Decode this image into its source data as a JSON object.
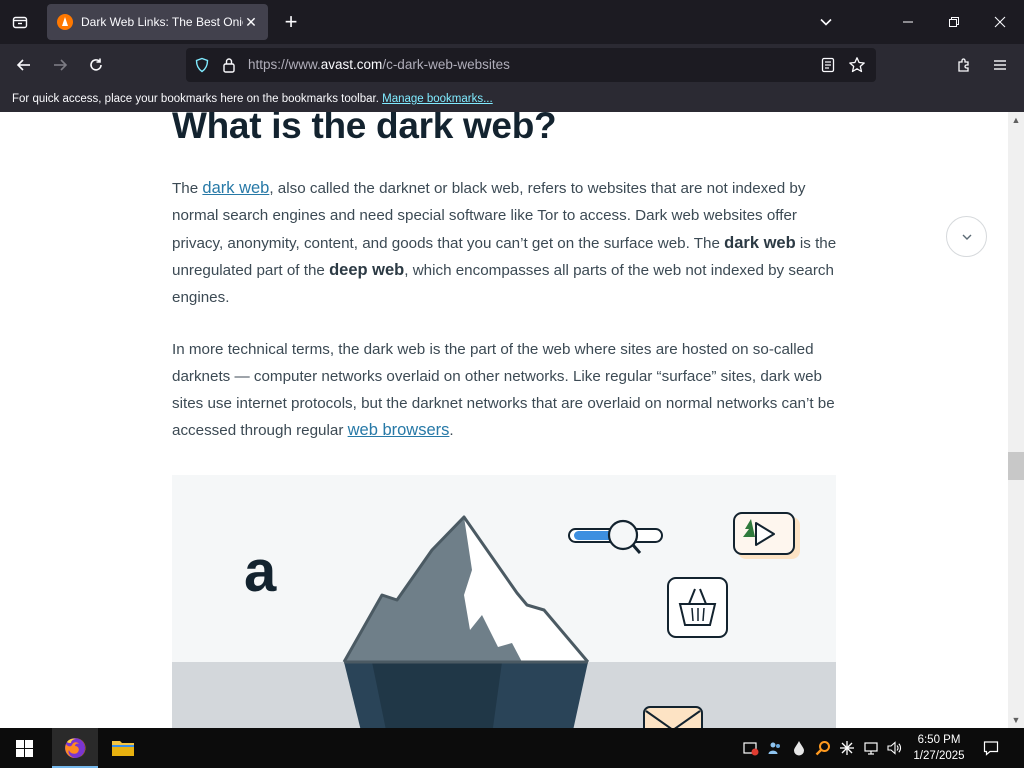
{
  "browser": {
    "tab": {
      "title": "Dark Web Links: The Best Onion"
    },
    "url": {
      "prefix": "https://www.",
      "host": "avast.com",
      "path": "/c-dark-web-websites"
    },
    "bookmarks_bar": {
      "text": "For quick access, place your bookmarks here on the bookmarks toolbar.",
      "link": "Manage bookmarks..."
    }
  },
  "article": {
    "heading": "What is the dark web?",
    "p1": {
      "t1": "The ",
      "l1": "dark web",
      "t2": ", also called the darknet or black web, refers to websites that are not indexed by normal search engines and need special software like Tor to access. Dark web websites offer privacy, anonymity, content, and goods that you can’t get on the surface web. The ",
      "b1": "dark web",
      "t3": " is the unregulated part of the ",
      "b2": "deep web",
      "t4": ", which encompasses all parts of the web not indexed by search engines."
    },
    "p2": {
      "t1": "In more technical terms, the dark web is the part of the web where sites are hosted on so-called darknets — computer networks overlaid on other networks. Like regular “surface” sites, dark web sites use internet protocols, but the darknet networks that are overlaid on normal networks can’t be accessed through regular ",
      "l1": "web browsers",
      "t2": "."
    },
    "illustration": {
      "logo_letter": "a"
    }
  },
  "taskbar": {
    "time": "6:50 PM",
    "date": "1/27/2025"
  }
}
